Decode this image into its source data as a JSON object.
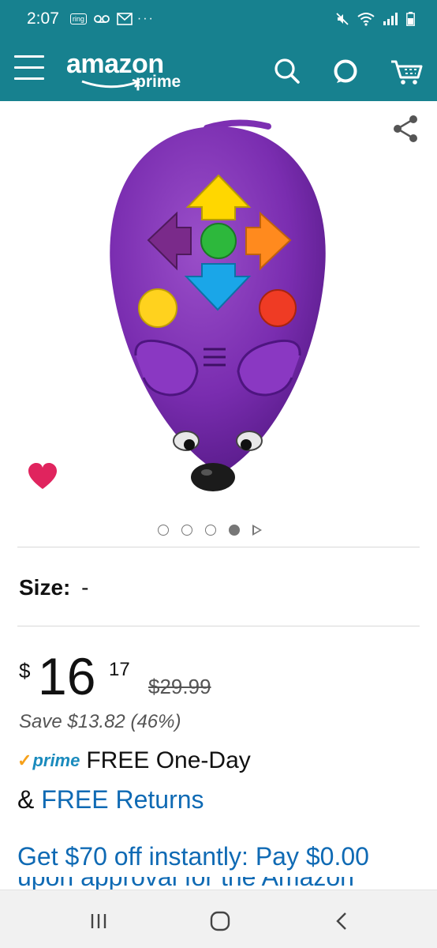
{
  "status_bar": {
    "time": "2:07",
    "notif_ring": "ring",
    "notif_voicemail_icon": "voicemail-icon",
    "notif_gmail_icon": "gmail-icon",
    "overflow": "···",
    "mute_icon": "mute-icon",
    "wifi_icon": "wifi-icon",
    "signal_icon": "signal-icon",
    "battery_icon": "battery-icon"
  },
  "header": {
    "brand": "amazon",
    "subbrand": "prime",
    "menu_icon": "hamburger-menu-icon",
    "search_icon": "search-icon",
    "alexa_icon": "alexa-icon",
    "cart_icon": "cart-icon",
    "bg_color": "#17818f"
  },
  "product": {
    "image_subject": "purple robot mouse with arrow buttons",
    "share_icon": "share-icon",
    "wishlist_icon": "heart-icon",
    "carousel_dots": 4,
    "carousel_active_index": 3,
    "size_label": "Size:",
    "size_value": "-",
    "price_currency": "$",
    "price_whole": "16",
    "price_fraction": "17",
    "list_price": "$29.99",
    "savings": "Save $13.82 (46%)",
    "prime_check": "✓",
    "prime_label": "prime",
    "delivery": "FREE One-Day",
    "returns_prefix": "& ",
    "returns_link": "FREE Returns",
    "offer_line1": "Get $70 off instantly: Pay $0.00",
    "offer_line2": "upon approval for the Amazon"
  },
  "nav": {
    "recents_icon": "recent-apps-icon",
    "home_icon": "home-icon",
    "back_icon": "back-icon"
  },
  "colors": {
    "accent": "#17818f",
    "link": "#0f6ab4",
    "heart": "#e0245e",
    "prime_check": "#f6a11b",
    "prime_blue": "#1a8bbd"
  }
}
